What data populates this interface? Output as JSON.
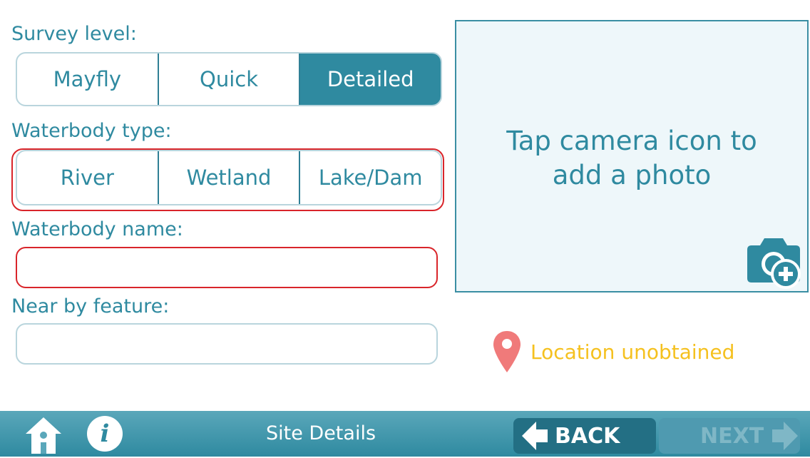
{
  "survey_level": {
    "label": "Survey level:",
    "options": [
      "Mayfly",
      "Quick",
      "Detailed"
    ],
    "selected": "Detailed"
  },
  "waterbody_type": {
    "label": "Waterbody type:",
    "options": [
      "River",
      "Wetland",
      "Lake/Dam"
    ]
  },
  "waterbody_name": {
    "label": "Waterbody name:",
    "value": "",
    "placeholder": ""
  },
  "near_by_feature": {
    "label": "Near by feature:",
    "value": "",
    "placeholder": ""
  },
  "photo": {
    "prompt_line1": "Tap camera icon to",
    "prompt_line2": "add a photo",
    "icon": "camera-add-icon"
  },
  "location": {
    "status": "Location unobtained",
    "icon": "map-pin-icon",
    "status_color": "#f5c11f"
  },
  "footer": {
    "title": "Site Details",
    "back_label": "BACK",
    "next_label": "NEXT",
    "home_icon": "home-icon",
    "info_icon": "info-icon",
    "info_glyph": "i"
  },
  "colors": {
    "accent": "#2f8aa0",
    "error": "#d9252a",
    "warning": "#f5c11f"
  }
}
